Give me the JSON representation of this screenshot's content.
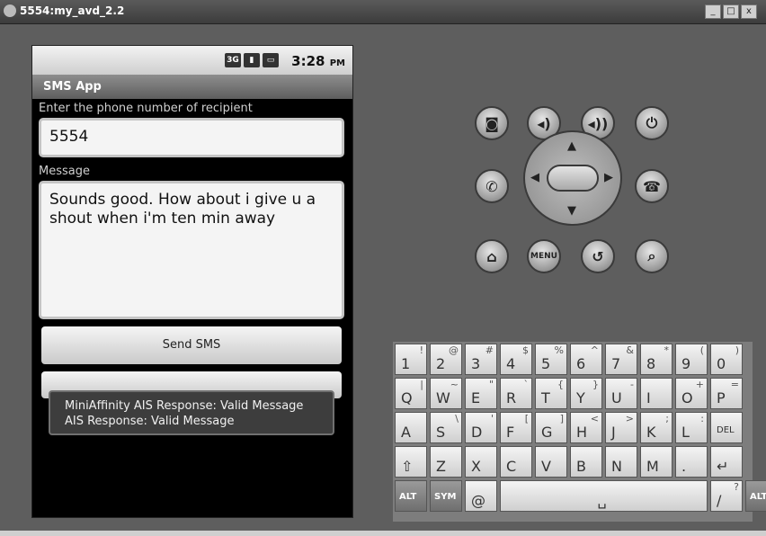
{
  "window": {
    "title": "5554:my_avd_2.2",
    "buttons": [
      "_",
      "□",
      "x"
    ]
  },
  "status_bar": {
    "icons": [
      "3G",
      "signal",
      "battery"
    ],
    "time": "3:28",
    "ampm": "PM"
  },
  "app": {
    "title": "SMS App",
    "phone_label": "Enter the phone number of recipient",
    "phone_value": "5554",
    "message_label": "Message",
    "message_value": "Sounds good. How about i give u a shout when i'm ten min away",
    "send_button": "Send SMS"
  },
  "toast": {
    "line1": "MiniAffinity AIS Response: Valid Message",
    "line2": "AIS Response: Valid Message"
  },
  "controls": {
    "row1": [
      "camera-icon",
      "volume-down-icon",
      "volume-up-icon",
      "power-icon"
    ],
    "row2": [
      "call-icon",
      "dpad",
      "end-call-icon"
    ],
    "row3_menu_label": "MENU"
  },
  "keyboard": {
    "row1": [
      [
        "1",
        "!"
      ],
      [
        "2",
        "@"
      ],
      [
        "3",
        "#"
      ],
      [
        "4",
        "$"
      ],
      [
        "5",
        "%"
      ],
      [
        "6",
        "^"
      ],
      [
        "7",
        "&"
      ],
      [
        "8",
        "*"
      ],
      [
        "9",
        "("
      ],
      [
        "0",
        ")"
      ]
    ],
    "row2": [
      [
        "Q",
        "|"
      ],
      [
        "W",
        "~"
      ],
      [
        "E",
        "\""
      ],
      [
        "R",
        "`"
      ],
      [
        "T",
        "{"
      ],
      [
        "Y",
        "}"
      ],
      [
        "U",
        "-"
      ],
      [
        "I",
        ""
      ],
      [
        "O",
        "+"
      ],
      [
        "P",
        "="
      ]
    ],
    "row3": [
      [
        "A",
        ""
      ],
      [
        "S",
        "\\"
      ],
      [
        "D",
        "'"
      ],
      [
        "F",
        "["
      ],
      [
        "G",
        "]"
      ],
      [
        "H",
        "<"
      ],
      [
        "J",
        ">"
      ],
      [
        "K",
        ";"
      ],
      [
        "L",
        ":"
      ],
      [
        "DEL",
        ""
      ]
    ],
    "row4": [
      [
        "⇧",
        ""
      ],
      [
        "Z",
        ""
      ],
      [
        "X",
        ""
      ],
      [
        "C",
        ""
      ],
      [
        "V",
        ""
      ],
      [
        "B",
        ""
      ],
      [
        "N",
        ""
      ],
      [
        "M",
        ""
      ],
      [
        ".",
        ""
      ],
      [
        "↵",
        ""
      ]
    ],
    "row5": [
      [
        "ALT",
        ""
      ],
      [
        "SYM",
        ""
      ],
      [
        "@",
        ""
      ],
      [
        "space",
        ""
      ],
      [
        "/",
        "?"
      ],
      [
        "ALT",
        ""
      ]
    ]
  }
}
